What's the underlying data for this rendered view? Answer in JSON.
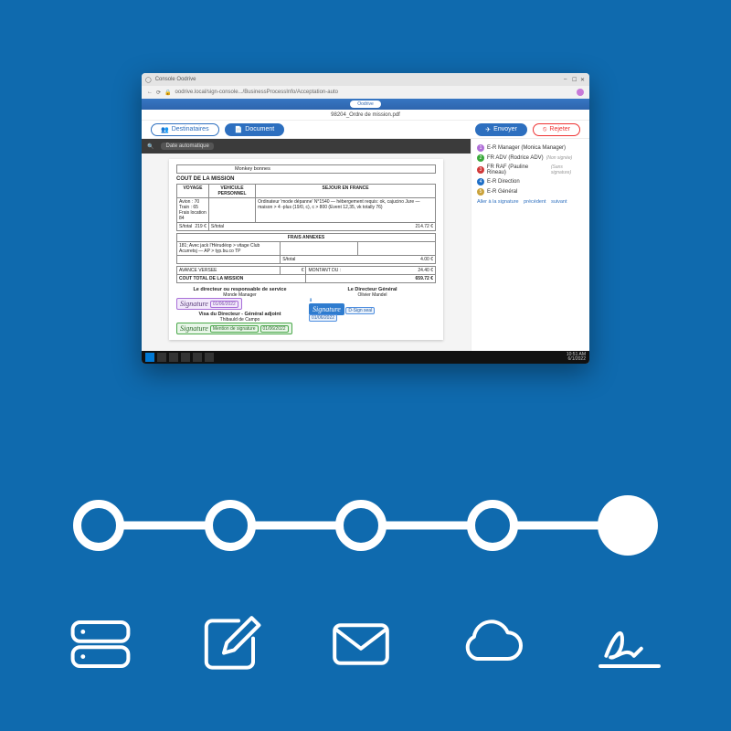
{
  "browser": {
    "tab_title": "Console Oodrive",
    "address": "oodrive.local/sign-console.../BusinessProcessInfo/Acceptation-auto",
    "window_controls": [
      "min",
      "max",
      "close"
    ]
  },
  "app": {
    "top_chip": "Oodrive",
    "doc_title": "98204_Ordre de mission.pdf",
    "toolbar": {
      "destinataires": "Destinataires",
      "document": "Document",
      "envoyer": "Envoyer",
      "rejeter": "Rejeter"
    },
    "doc_header": {
      "search_label": "",
      "mode": "Date automatique"
    }
  },
  "document": {
    "field_name": "Monkey bonnes",
    "section_cost": "COUT DE LA MISSION",
    "table_headers": {
      "voyage": "VOYAGE",
      "vehicule": "VEHICULE PERSONNEL",
      "sejour": "SEJOUR EN FRANCE"
    },
    "voyage_rows": [
      "Avion : 70",
      "Train : 65",
      "Frais location 84"
    ],
    "sejour_text": "Ordinateur 'mode dépanne' N°1540 — hébergement requis: ok, cajucino Jure — maison > 4 -plus (19/0, c), c > 800 (Event 12,35, vk totally 76)",
    "stotal_left_label": "S/total",
    "stotal_left_value": "219",
    "stotal_left_currency": "€",
    "stotal_right_label": "S/total",
    "stotal_right_value": "214.72",
    "stotal_right_currency": "€",
    "frais_annexes": "FRAIS ANNEXES",
    "frais_text": "181; Avec jack l'Hérudéop > vitage Club Acurretsj — AP > typ.bu.co TP",
    "frais_stotal_label": "S/total",
    "frais_stotal_value": "4.00",
    "frais_stotal_currency": "€",
    "avance_label": "AVANCE VERSEE",
    "avance_currency": "€",
    "montant_du_label": "MONTANT DU :",
    "montant_du_value": "24.40",
    "montant_du_currency": "€",
    "cout_total_label": "COUT TOTAL DE LA MISSION",
    "cout_total_value": "659.72",
    "cout_total_currency": "€",
    "sign_left_title": "Le directeur ou responsable de service",
    "sign_left_name": "Monde Manager",
    "sign_left_date": "01/06/2022",
    "sign_mid_title": "Visa du Directeur - Général adjoint",
    "sign_mid_name": "Thibauld de Campo",
    "sign_mid_role": "Mention de signature",
    "sign_mid_date": "01/06/2022",
    "sign_right_title": "Le Directeur Général",
    "sign_right_name": "Olivier Mandel",
    "sign_right_stamp": "D-Sign seal",
    "sign_right_date": "01/06/2022",
    "signature_word": "Signature"
  },
  "recipients": [
    {
      "color": "#b06fd8",
      "num": "1",
      "label": "E-R Manager (Monica Manager)",
      "status": ""
    },
    {
      "color": "#3aa93a",
      "num": "2",
      "label": "FR ADV (Rodrice ADV)",
      "status": "(Non signée)"
    },
    {
      "color": "#d13838",
      "num": "3",
      "label": "FR RAF (Pauline Rineau)",
      "status": "(Sans signature)"
    },
    {
      "color": "#1f6fc7",
      "num": "4",
      "label": "E-R Direction",
      "status": ""
    },
    {
      "color": "#caa23a",
      "num": "5",
      "label": "E-R Général",
      "status": ""
    }
  ],
  "side_actions": {
    "a1": "Aller à la signature",
    "a2": "précédent",
    "a3": "suivant"
  },
  "taskbar": {
    "time": "10:51 AM",
    "date": "6/1/2022"
  },
  "steps": {
    "count": 5,
    "active_index": 4,
    "icons": [
      "server",
      "edit",
      "mail",
      "cloud",
      "signature"
    ]
  }
}
